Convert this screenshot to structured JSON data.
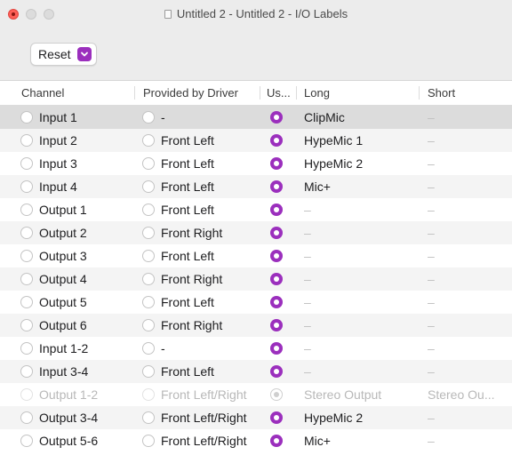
{
  "window": {
    "title": "Untitled 2 - Untitled 2 - I/O Labels",
    "accent": "#9b2fbd"
  },
  "toolbar": {
    "reset_label": "Reset"
  },
  "columns": [
    "Channel",
    "Provided by Driver",
    "Us...",
    "Long",
    "Short"
  ],
  "rows": [
    {
      "channel": "Input 1",
      "provided": "-",
      "used": true,
      "long": "ClipMic",
      "short": "–"
    },
    {
      "channel": "Input 2",
      "provided": "Front Left",
      "used": true,
      "long": "HypeMic 1",
      "short": "–"
    },
    {
      "channel": "Input 3",
      "provided": "Front Left",
      "used": true,
      "long": "HypeMic 2",
      "short": "–"
    },
    {
      "channel": "Input 4",
      "provided": "Front Left",
      "used": true,
      "long": "Mic+",
      "short": "–"
    },
    {
      "channel": "Output 1",
      "provided": "Front Left",
      "used": true,
      "long": "–",
      "short": "–"
    },
    {
      "channel": "Output 2",
      "provided": "Front Right",
      "used": true,
      "long": "–",
      "short": "–"
    },
    {
      "channel": "Output 3",
      "provided": "Front Left",
      "used": true,
      "long": "–",
      "short": "–"
    },
    {
      "channel": "Output 4",
      "provided": "Front Right",
      "used": true,
      "long": "–",
      "short": "–"
    },
    {
      "channel": "Output 5",
      "provided": "Front Left",
      "used": true,
      "long": "–",
      "short": "–"
    },
    {
      "channel": "Output 6",
      "provided": "Front Right",
      "used": true,
      "long": "–",
      "short": "–"
    },
    {
      "channel": "Input 1-2",
      "provided": "-",
      "used": true,
      "long": "–",
      "short": "–"
    },
    {
      "channel": "Input 3-4",
      "provided": "Front Left",
      "used": true,
      "long": "–",
      "short": "–"
    },
    {
      "channel": "Output 1-2",
      "provided": "Front Left/Right",
      "used": false,
      "long": "Stereo Output",
      "short": "Stereo Ou..."
    },
    {
      "channel": "Output 3-4",
      "provided": "Front Left/Right",
      "used": true,
      "long": "HypeMic 2",
      "short": "–"
    },
    {
      "channel": "Output 5-6",
      "provided": "Front Left/Right",
      "used": true,
      "long": "Mic+",
      "short": "–"
    }
  ]
}
